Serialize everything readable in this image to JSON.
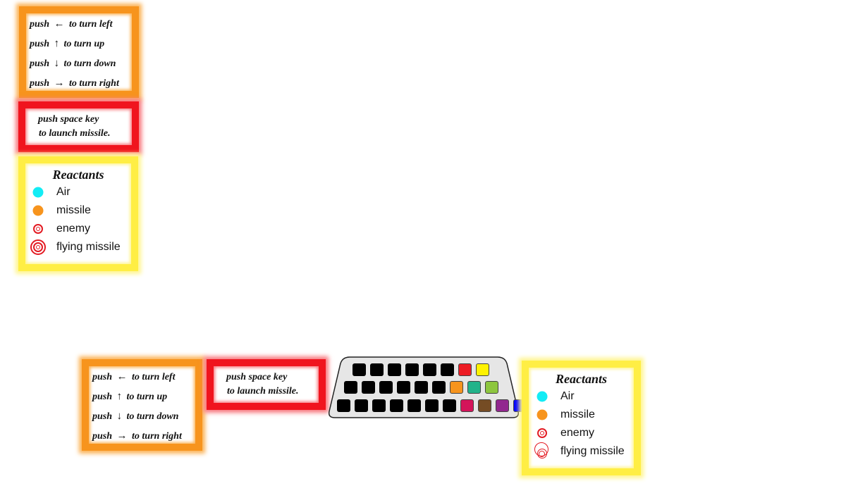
{
  "instructions": {
    "left_label": "push ← to turn left",
    "up_label": "push ↑ to turn up",
    "down_label": "push ↓ to turn down",
    "right_label": "push → to turn right",
    "push_word": "push",
    "left_arrow": "←",
    "up_arrow": "↑",
    "down_arrow": "↓",
    "right_arrow": "→",
    "left_text": "to turn left",
    "up_text": "to turn up",
    "down_text": "to turn down",
    "right_text": "to turn right"
  },
  "launch": {
    "line1": "push space key",
    "line2": "to launch missile."
  },
  "reactants": {
    "title": "Reactants",
    "items": [
      {
        "label": "Air",
        "color": "#13ecf5",
        "icon": "cyan-dot-icon"
      },
      {
        "label": "missile",
        "color": "#f7941d",
        "icon": "orange-dot-icon"
      },
      {
        "label": "enemy",
        "color": "#e31b23",
        "icon": "double-ring-icon"
      },
      {
        "label": "flying missile",
        "color": "#e31b23",
        "icon": "triple-ring-icon"
      }
    ]
  },
  "keyboard": {
    "colors": {
      "row1": [
        "#000000",
        "#000000",
        "#000000",
        "#000000",
        "#000000",
        "#000000",
        "#ed1c24",
        "#fff200"
      ],
      "row2": [
        "#000000",
        "#000000",
        "#000000",
        "#000000",
        "#000000",
        "#000000",
        "#f7941d",
        "#22b38a",
        "#8dc63f"
      ],
      "row3": [
        "#000000",
        "#000000",
        "#000000",
        "#000000",
        "#000000",
        "#000000",
        "#000000",
        "#d4145a",
        "#754c24",
        "#92278f",
        "#0000ff"
      ]
    }
  }
}
